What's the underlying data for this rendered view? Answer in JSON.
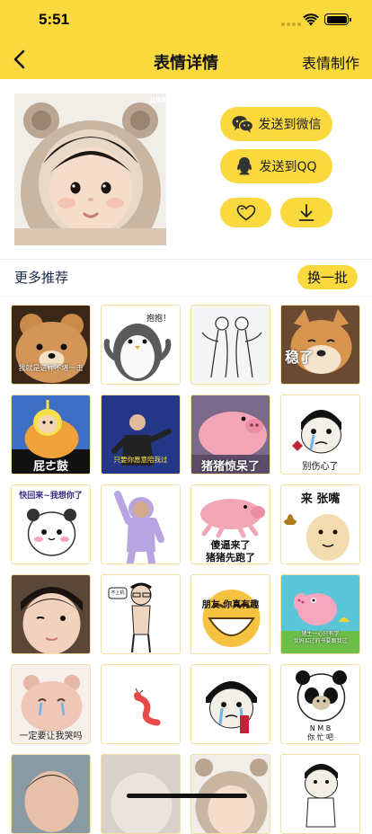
{
  "status_bar": {
    "time": "5:51"
  },
  "nav": {
    "title": "表情详情",
    "action": "表情制作"
  },
  "detail": {
    "watermark": "JiBB",
    "actions": {
      "send_wechat": "发送到微信",
      "send_qq": "发送到QQ"
    }
  },
  "recommend": {
    "title": "更多推荐",
    "refresh": "换一批"
  },
  "colors": {
    "accent": "#fad93f",
    "cell_border": "#f3e0a4"
  },
  "stickers": [
    {
      "caption": "我就是这样不堪一击"
    },
    {
      "caption": "抱抱！"
    },
    {
      "caption": ""
    },
    {
      "caption": "稳了"
    },
    {
      "caption": "屁ㄜ鼓"
    },
    {
      "caption": "只要你愿意陪我过"
    },
    {
      "caption": "猪猪惊呆了"
    },
    {
      "caption": "别伤心了"
    },
    {
      "caption": "快回来~我想你了"
    },
    {
      "caption": ""
    },
    {
      "caption": "傻逼来了\n猪猪先跑了"
    },
    {
      "caption": "来 张嘴"
    },
    {
      "caption": ""
    },
    {
      "caption": "不上机"
    },
    {
      "caption": "朋友 你真有趣\n我都笑了"
    },
    {
      "caption": "猪生一心只有学\n我妈买过的书要跟我过"
    },
    {
      "caption": "一定要让我哭吗"
    },
    {
      "caption": ""
    },
    {
      "caption": ""
    },
    {
      "caption": "N M B\n你 忙 吧"
    },
    {
      "caption": ""
    },
    {
      "caption": ""
    },
    {
      "caption": ""
    },
    {
      "caption": ""
    }
  ]
}
